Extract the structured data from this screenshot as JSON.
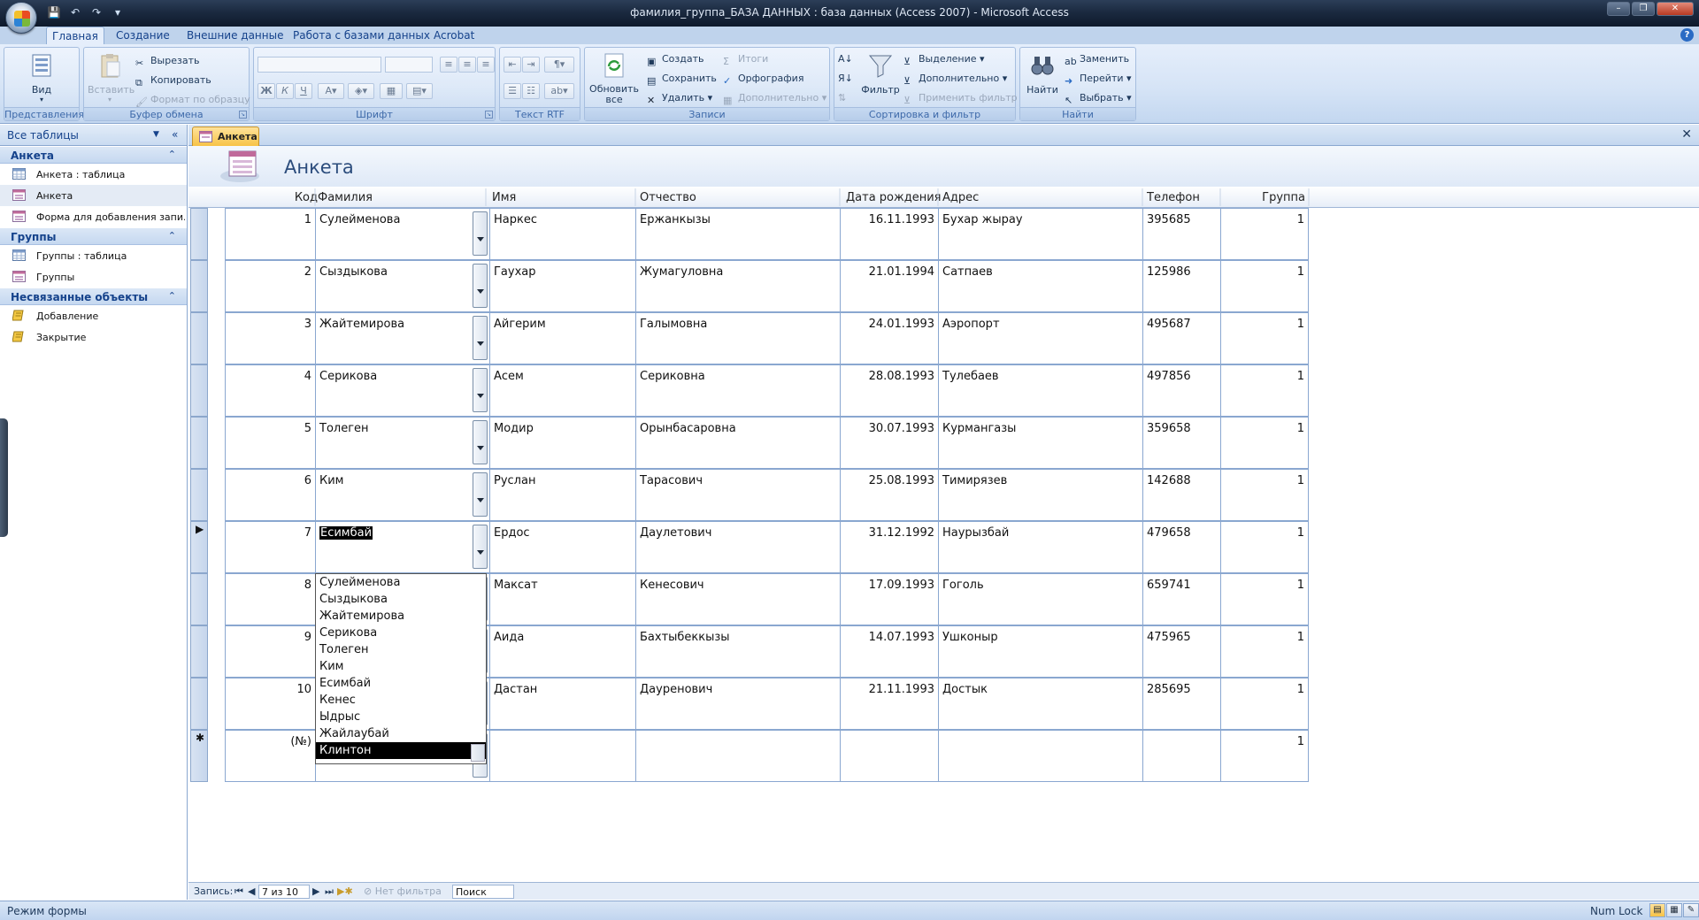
{
  "window": {
    "title": "фамилия_группа_БАЗА ДАННЫХ : база данных (Access 2007) - Microsoft Access",
    "minimize": "–",
    "restore": "❐",
    "close": "✕"
  },
  "ribbon_tabs": [
    "Главная",
    "Создание",
    "Внешние данные",
    "Работа с базами данных",
    "Acrobat"
  ],
  "ribbon": {
    "views": {
      "name": "Представления",
      "view_label": "Вид"
    },
    "clipboard": {
      "name": "Буфер обмена",
      "paste": "Вставить",
      "cut": "Вырезать",
      "copy": "Копировать",
      "format_painter": "Формат по образцу"
    },
    "font": {
      "name": "Шрифт",
      "bold": "Ж",
      "italic": "К",
      "underline": "Ч"
    },
    "rtf": {
      "name": "Текст RTF"
    },
    "records": {
      "name": "Записи",
      "refresh": "Обновить все",
      "new": "Создать",
      "save": "Сохранить",
      "delete": "Удалить",
      "totals": "Итоги",
      "spelling": "Орфография",
      "more": "Дополнительно"
    },
    "sort_filter": {
      "name": "Сортировка и фильтр",
      "filter": "Фильтр",
      "selection": "Выделение",
      "advanced": "Дополнительно",
      "toggle": "Применить фильтр"
    },
    "find": {
      "name": "Найти",
      "find": "Найти",
      "replace": "Заменить",
      "goto": "Перейти",
      "select": "Выбрать"
    }
  },
  "nav_pane": {
    "header": "Все таблицы",
    "groups": [
      {
        "title": "Анкета",
        "items": [
          "Анкета : таблица",
          "Анкета",
          "Форма для добавления запи..."
        ]
      },
      {
        "title": "Группы",
        "items": [
          "Группы : таблица",
          "Группы"
        ]
      },
      {
        "title": "Несвязанные объекты",
        "items": [
          "Добавление",
          "Закрытие"
        ]
      }
    ]
  },
  "document": {
    "tab": "Анкета",
    "form_title": "Анкета",
    "columns": [
      "Код",
      "Фамилия",
      "Имя",
      "Отчество",
      "Дата рождения",
      "Адрес",
      "Телефон",
      "Группа"
    ],
    "records": [
      {
        "code": "1",
        "surname": "Сулейменова",
        "name": "Наркес",
        "patronymic": "Ержанкызы",
        "birth": "16.11.1993",
        "address": "Бухар жырау",
        "phone": "395685",
        "group": "1"
      },
      {
        "code": "2",
        "surname": "Сыздыкова",
        "name": "Гаухар",
        "patronymic": "Жумагуловна",
        "birth": "21.01.1994",
        "address": "Сатпаев",
        "phone": "125986",
        "group": "1"
      },
      {
        "code": "3",
        "surname": "Жайтемирова",
        "name": "Айгерим",
        "patronymic": "Галымовна",
        "birth": "24.01.1993",
        "address": "Аэропорт",
        "phone": "495687",
        "group": "1"
      },
      {
        "code": "4",
        "surname": "Серикова",
        "name": "Асем",
        "patronymic": "Сериковна",
        "birth": "28.08.1993",
        "address": "Тулебаев",
        "phone": "497856",
        "group": "1"
      },
      {
        "code": "5",
        "surname": "Толеген",
        "name": "Модир",
        "patronymic": "Орынбасаровна",
        "birth": "30.07.1993",
        "address": "Курмангазы",
        "phone": "359658",
        "group": "1"
      },
      {
        "code": "6",
        "surname": "Ким",
        "name": "Руслан",
        "patronymic": "Тарасович",
        "birth": "25.08.1993",
        "address": "Тимирязев",
        "phone": "142688",
        "group": "1"
      },
      {
        "code": "7",
        "surname": "Есимбай",
        "name": "Ердос",
        "patronymic": "Даулетович",
        "birth": "31.12.1992",
        "address": "Наурызбай",
        "phone": "479658",
        "group": "1"
      },
      {
        "code": "8",
        "surname": "",
        "name": "Максат",
        "patronymic": "Кенесович",
        "birth": "17.09.1993",
        "address": "Гоголь",
        "phone": "659741",
        "group": "1"
      },
      {
        "code": "9",
        "surname": "",
        "name": "Аида",
        "patronymic": "Бахтыбеккызы",
        "birth": "14.07.1993",
        "address": "Ушконыр",
        "phone": "475965",
        "group": "1"
      },
      {
        "code": "10",
        "surname": "",
        "name": "Дастан",
        "patronymic": "Дауренович",
        "birth": "21.11.1993",
        "address": "Достык",
        "phone": "285695",
        "group": "1"
      },
      {
        "code": "(№)",
        "surname": "",
        "name": "",
        "patronymic": "",
        "birth": "",
        "address": "",
        "phone": "",
        "group": "1"
      }
    ],
    "current_record_index": 6,
    "new_record_marker": "✱",
    "current_marker": "▶",
    "dropdown_options": [
      "Сулейменова",
      "Сыздыкова",
      "Жайтемирова",
      "Серикова",
      "Толеген",
      "Ким",
      "Есимбай",
      "Кенес",
      "Ыдрыс",
      "Жайлаубай",
      "Клинтон"
    ],
    "dropdown_selected": "Клинтон"
  },
  "record_nav": {
    "label": "Запись:",
    "position": "7 из 10",
    "filter": "Нет фильтра",
    "search": "Поиск"
  },
  "status": {
    "mode": "Режим формы",
    "numlock": "Num Lock"
  }
}
